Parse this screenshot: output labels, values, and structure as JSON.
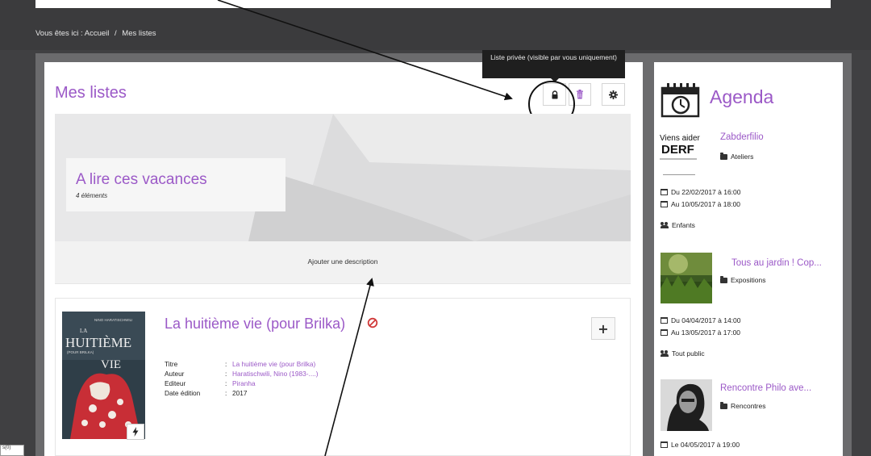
{
  "breadcrumb": {
    "prefix": "Vous êtes ici :",
    "home": "Accueil",
    "separator": "/",
    "current": "Mes listes"
  },
  "page": {
    "title": "Mes listes"
  },
  "toolbar": {
    "lock_icon": "lock-icon",
    "trash_icon": "trash-icon",
    "gear_icon": "gear-icon",
    "tooltip": "Liste privée (visible par vous uniquement)"
  },
  "list": {
    "title": "A lire ces vacances",
    "count": "4 éléments",
    "add_description": "Ajouter une description"
  },
  "item": {
    "title": "La huitième vie (pour Brilka)",
    "fields": [
      {
        "label": "Titre",
        "value": "La huitième vie (pour Brilka)",
        "link": true
      },
      {
        "label": "Auteur",
        "value": "Haratischwili, Nino (1983-....)",
        "link": true
      },
      {
        "label": "Editeur",
        "value": "Piranha",
        "link": true
      },
      {
        "label": "Date édition",
        "value": "2017",
        "link": false
      }
    ],
    "add_button": "+",
    "cover_author": "NINO HARATISCHWILI",
    "cover_title_1": "LA",
    "cover_title_2": "HUITIÈME",
    "cover_title_3": "VIE",
    "cover_subtitle": "(POUR BRILKA)"
  },
  "agenda": {
    "title": "Agenda",
    "events": [
      {
        "thumb_line1": "Viens aider",
        "thumb_line2": "DERF",
        "title": "Zabderfilio",
        "category": "Ateliers",
        "date1": "Du 22/02/2017 à 16:00",
        "date2": "Au 10/05/2017 à 18:00",
        "audience": "Enfants"
      },
      {
        "title": "Tous au jardin ! Cop...",
        "category": "Expositions",
        "date1": "Du 04/04/2017 à 14:00",
        "date2": "Au 13/05/2017 à 17:00",
        "audience": "Tout public"
      },
      {
        "title": "Rencontre Philo ave...",
        "category": "Rencontres",
        "date1": "Le 04/05/2017 à 19:00"
      }
    ]
  },
  "corner_tag": "s(0)",
  "colors": {
    "accent": "#9b59c7",
    "dark": "#3b3b3d"
  }
}
